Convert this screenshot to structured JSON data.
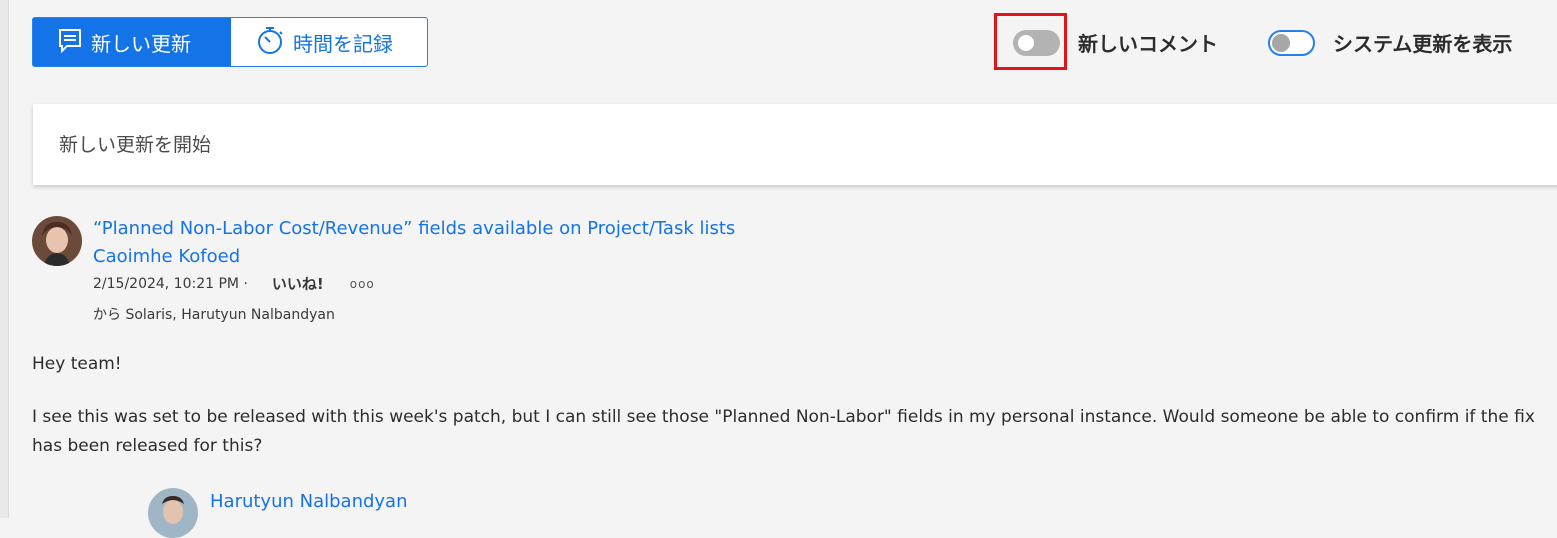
{
  "toolbar": {
    "new_update_label": "新しい更新",
    "log_time_label": "時間を記録"
  },
  "toggles": {
    "new_comment_label": "新しいコメント",
    "system_updates_label": "システム更新を表示"
  },
  "composer": {
    "placeholder": "新しい更新を開始"
  },
  "post": {
    "title": "“Planned Non-Labor Cost/Revenue” fields available on Project/Task lists",
    "author": "Caoimhe Kofoed",
    "timestamp": "2/15/2024, 10:21 PM ·",
    "like_label": "いいね!",
    "more_label": "ooo",
    "from_label": "から Solaris, Harutyun Nalbandyan",
    "greeting": "Hey team!",
    "body_line1": "I see this was set to be released with this week's patch, but I can still see those \"Planned Non-Labor\" fields in my personal instance. Would someone be able to confirm if the fix",
    "body_line2": "has been released for this?"
  },
  "reply": {
    "author": "Harutyun Nalbandyan"
  },
  "colors": {
    "accent": "#1473e6",
    "highlight": "#e0141b"
  },
  "icons": {
    "new_update": "comment-lines-icon",
    "log_time": "stopwatch-icon"
  }
}
